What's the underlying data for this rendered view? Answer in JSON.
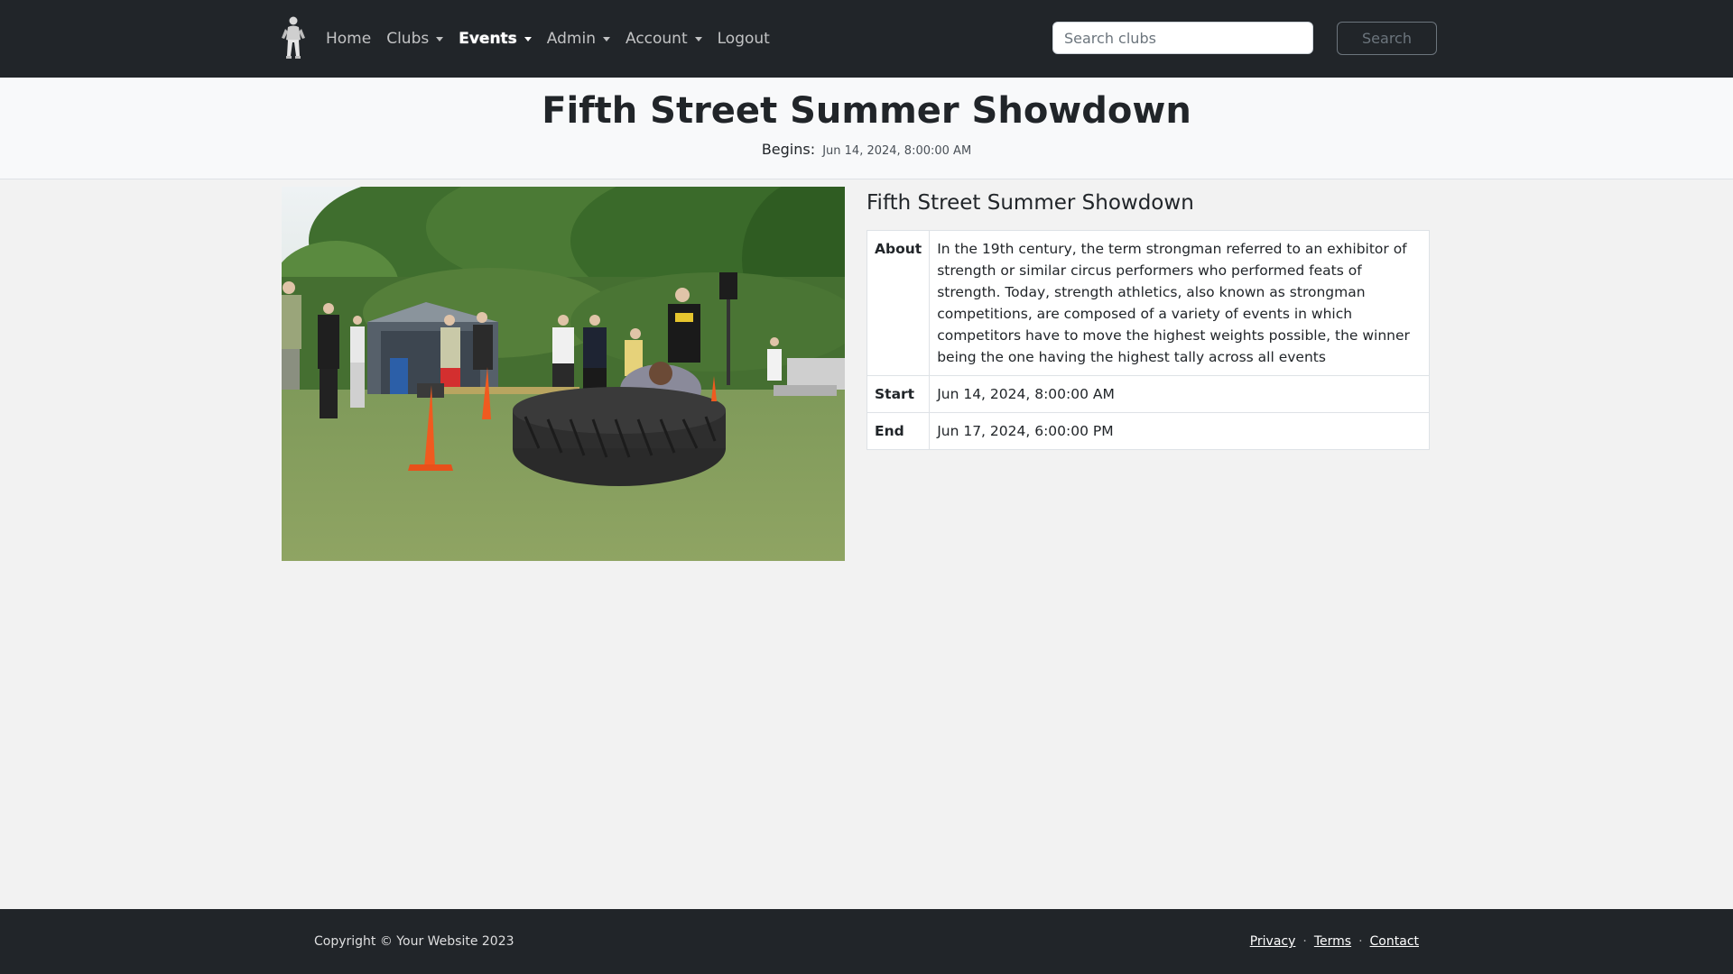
{
  "nav": {
    "logo_icon": "strongman-logo-icon",
    "items": [
      {
        "label": "Home",
        "dropdown": false
      },
      {
        "label": "Clubs",
        "dropdown": true
      },
      {
        "label": "Events",
        "dropdown": true,
        "active": true
      },
      {
        "label": "Admin",
        "dropdown": true
      },
      {
        "label": "Account",
        "dropdown": true
      },
      {
        "label": "Logout",
        "dropdown": false
      }
    ],
    "search_placeholder": "Search clubs",
    "search_button": "Search"
  },
  "header": {
    "title": "Fifth Street Summer Showdown",
    "begins_label": "Begins:",
    "begins_value": "Jun 14, 2024, 8:00:00 AM"
  },
  "event": {
    "image_icon": "strongman-tire-flip-photo",
    "title": "Fifth Street Summer Showdown",
    "rows": [
      {
        "label": "About",
        "value": "In the 19th century, the term strongman referred to an exhibitor of strength or similar circus performers who performed feats of strength. Today, strength athletics, also known as strongman competitions, are composed of a variety of events in which competitors have to move the highest weights possible, the winner being the one having the highest tally across all events"
      },
      {
        "label": "Start",
        "value": "Jun 14, 2024, 8:00:00 AM"
      },
      {
        "label": "End",
        "value": "Jun 17, 2024, 6:00:00 PM"
      }
    ]
  },
  "footer": {
    "copyright": "Copyright © Your Website 2023",
    "links": [
      "Privacy",
      "Terms",
      "Contact"
    ],
    "separator": "·"
  },
  "colors": {
    "navbar": "#212529",
    "page_bg": "#f2f2f2",
    "header_bg": "#f8f9fa"
  }
}
